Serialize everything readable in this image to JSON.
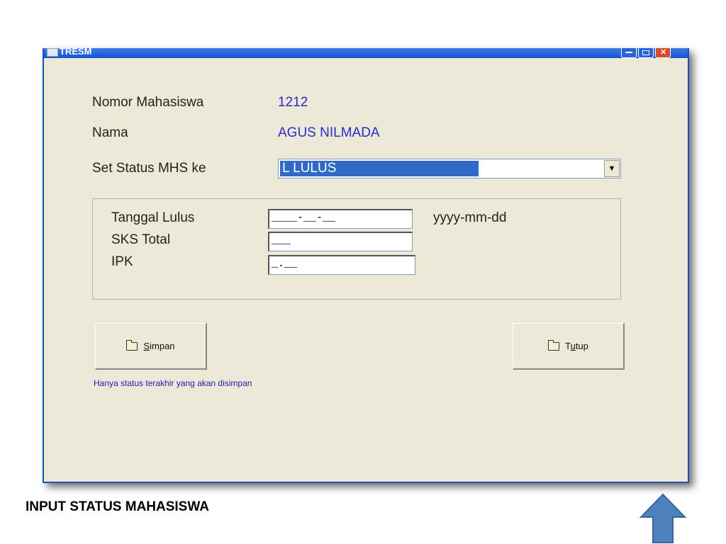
{
  "window": {
    "title": "TRESM",
    "controls": [
      "minimize",
      "maximize",
      "close"
    ]
  },
  "form": {
    "nomor_label": "Nomor Mahasiswa",
    "nomor_value": "1212",
    "nama_label": "Nama",
    "nama_value": "AGUS NILMADA",
    "status_label": "Set Status MHS ke",
    "status_selected": "L LULUS",
    "group": {
      "tanggal_label": "Tanggal Lulus",
      "tanggal_value": "____-__-__",
      "tanggal_hint": "yyyy-mm-dd",
      "sks_label": "SKS Total",
      "sks_value": "___",
      "ipk_label": "IPK",
      "ipk_value": "_.__"
    },
    "simpan_prefix": "",
    "simpan_underlined": "S",
    "simpan_rest": "impan",
    "tutup_prefix": "T",
    "tutup_underlined": "u",
    "tutup_rest": "tup",
    "note": "Hanya status terakhir yang akan disimpan"
  },
  "slide": {
    "caption": "INPUT STATUS MAHASISWA",
    "arrow_icon": "up-arrow-icon",
    "arrow_color": "#4f81bd"
  }
}
